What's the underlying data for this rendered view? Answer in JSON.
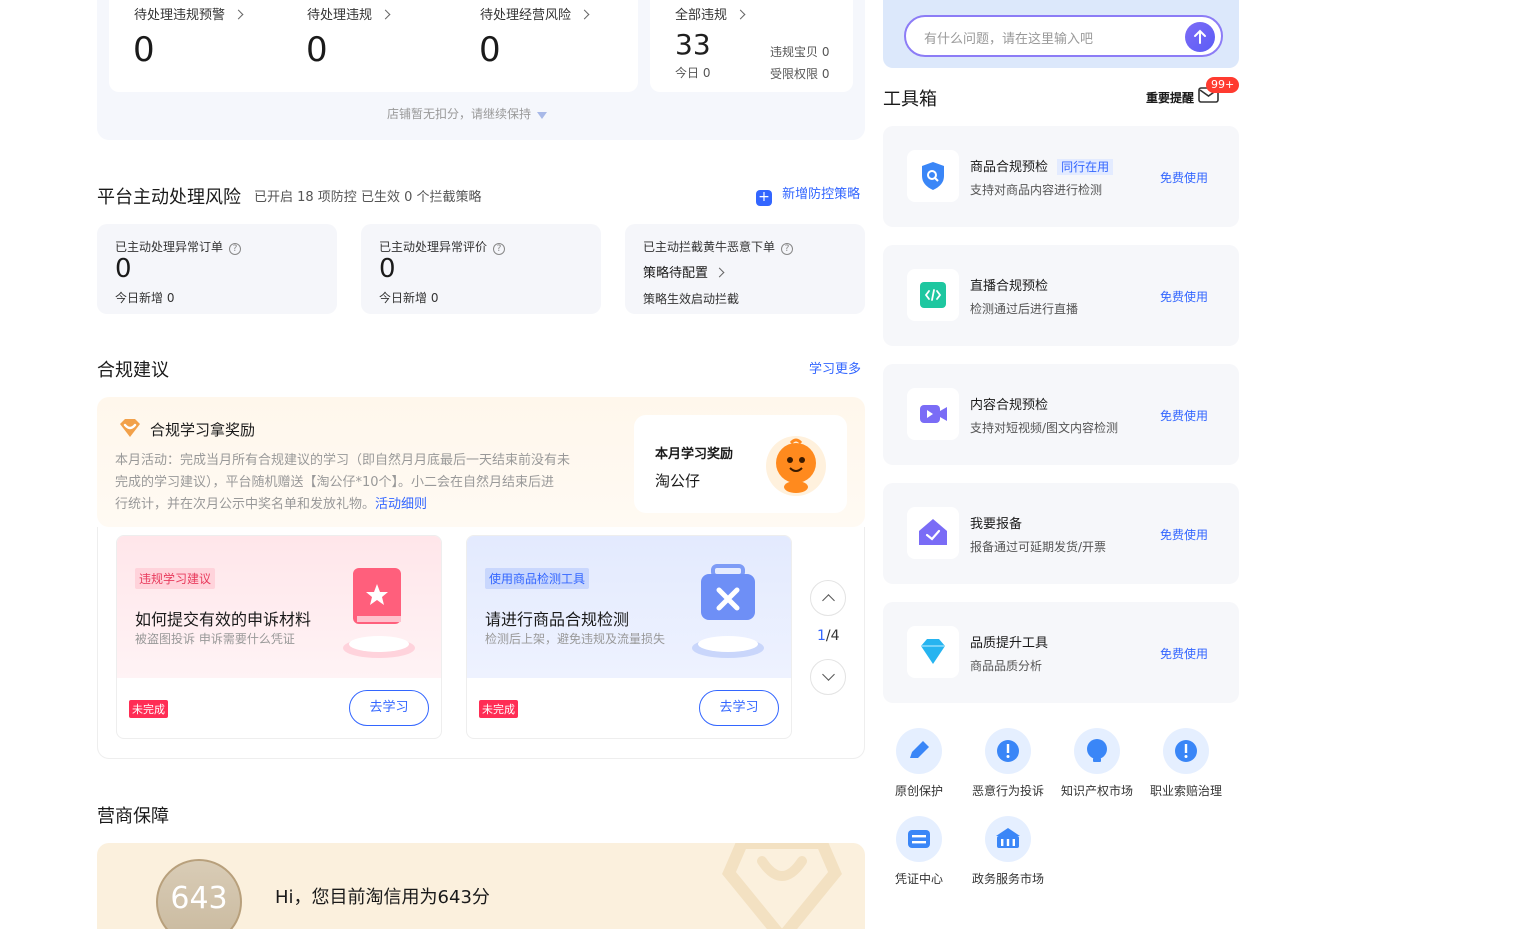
{
  "top_stats": {
    "cards": [
      {
        "label": "待处理违规预警",
        "value": "0"
      },
      {
        "label": "待处理违规",
        "value": "0"
      },
      {
        "label": "待处理经营风险",
        "value": "0"
      }
    ],
    "all": {
      "label": "全部违规",
      "value": "33",
      "today": "今日 0",
      "treasure": "违规宝贝 0",
      "limited": "受限权限 0"
    },
    "hint": "店铺暂无扣分，请继续保持"
  },
  "platform_risk": {
    "title": "平台主动处理风险",
    "subtitle": "已开启 18 项防控 已生效 0 个拦截策略",
    "add_link": "新增防控策略",
    "cards": [
      {
        "label": "已主动处理异常订单",
        "value": "0",
        "sub": "今日新增 0"
      },
      {
        "label": "已主动处理异常评价",
        "value": "0",
        "sub": "今日新增 0"
      },
      {
        "label": "已主动拦截黄牛恶意下单",
        "value": "策略待配置",
        "sub": "策略生效启动拦截"
      }
    ]
  },
  "compliance": {
    "title": "合规建议",
    "more_link": "学习更多",
    "reward": {
      "title": "合规学习拿奖励",
      "desc_line1": "本月活动：完成当月所有合规建议的学习（即自然月月底最后一天结束前没有未",
      "desc_line2": "完成的学习建议），平台随机赠送【淘公仔*10个】。小二会在自然月结束后进",
      "desc_line3": "行统计，并在次月公示中奖名单和发放礼物。",
      "rules_link": "活动细则",
      "box_title": "本月学习奖励",
      "box_prize": "淘公仔"
    },
    "cards": [
      {
        "tag": "违规学习建议",
        "title": "如何提交有效的申诉材料",
        "sub": "被盗图投诉 申诉需要什么凭证",
        "status": "未完成",
        "button": "去学习"
      },
      {
        "tag": "使用商品检测工具",
        "title": "请进行商品合规检测",
        "sub": "检测后上架，避免违规及流量损失",
        "status": "未完成",
        "button": "去学习"
      }
    ],
    "pager_current": "1",
    "pager_total": "/4"
  },
  "guarantee": {
    "title": "营商保障",
    "score": "643",
    "greeting": "Hi，您目前淘信用为643分"
  },
  "ai": {
    "placeholder": "有什么问题，请在这里输入吧"
  },
  "toolbox": {
    "title": "工具箱",
    "reminder": "重要提醒",
    "badge": "99+",
    "tools": [
      {
        "name": "商品合规预检",
        "tag": "同行在用",
        "desc": "支持对商品内容进行检测",
        "action": "免费使用",
        "icon": "shield-search-icon"
      },
      {
        "name": "直播合规预检",
        "desc": "检测通过后进行直播",
        "action": "免费使用",
        "icon": "code-icon"
      },
      {
        "name": "内容合规预检",
        "desc": "支持对短视频/图文内容检测",
        "action": "免费使用",
        "icon": "video-icon"
      },
      {
        "name": "我要报备",
        "desc": "报备通过可延期发货/开票",
        "action": "免费使用",
        "icon": "house-check-icon"
      },
      {
        "name": "品质提升工具",
        "desc": "商品品质分析",
        "action": "免费使用",
        "icon": "diamond-icon"
      }
    ],
    "quick": [
      {
        "label": "原创保护"
      },
      {
        "label": "恶意行为投诉"
      },
      {
        "label": "知识产权市场"
      },
      {
        "label": "职业索赔治理"
      },
      {
        "label": "凭证中心"
      },
      {
        "label": "政务服务市场"
      }
    ]
  },
  "colors": {
    "accent": "#3366ff",
    "danger": "#ff2d55",
    "ai_border": "#8c7cf6"
  }
}
